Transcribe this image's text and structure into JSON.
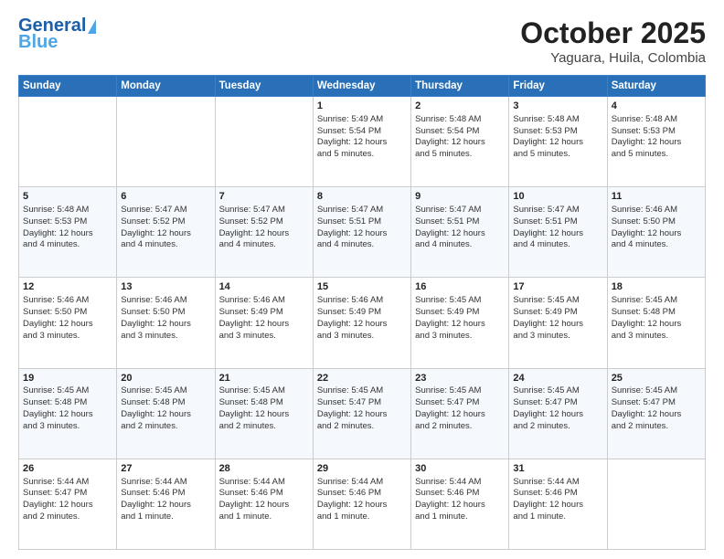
{
  "header": {
    "logo_line1": "General",
    "logo_line2": "Blue",
    "title": "October 2025",
    "subtitle": "Yaguara, Huila, Colombia"
  },
  "days_of_week": [
    "Sunday",
    "Monday",
    "Tuesday",
    "Wednesday",
    "Thursday",
    "Friday",
    "Saturday"
  ],
  "weeks": [
    [
      {
        "day": "",
        "info": ""
      },
      {
        "day": "",
        "info": ""
      },
      {
        "day": "",
        "info": ""
      },
      {
        "day": "1",
        "info": "Sunrise: 5:49 AM\nSunset: 5:54 PM\nDaylight: 12 hours\nand 5 minutes."
      },
      {
        "day": "2",
        "info": "Sunrise: 5:48 AM\nSunset: 5:54 PM\nDaylight: 12 hours\nand 5 minutes."
      },
      {
        "day": "3",
        "info": "Sunrise: 5:48 AM\nSunset: 5:53 PM\nDaylight: 12 hours\nand 5 minutes."
      },
      {
        "day": "4",
        "info": "Sunrise: 5:48 AM\nSunset: 5:53 PM\nDaylight: 12 hours\nand 5 minutes."
      }
    ],
    [
      {
        "day": "5",
        "info": "Sunrise: 5:48 AM\nSunset: 5:53 PM\nDaylight: 12 hours\nand 4 minutes."
      },
      {
        "day": "6",
        "info": "Sunrise: 5:47 AM\nSunset: 5:52 PM\nDaylight: 12 hours\nand 4 minutes."
      },
      {
        "day": "7",
        "info": "Sunrise: 5:47 AM\nSunset: 5:52 PM\nDaylight: 12 hours\nand 4 minutes."
      },
      {
        "day": "8",
        "info": "Sunrise: 5:47 AM\nSunset: 5:51 PM\nDaylight: 12 hours\nand 4 minutes."
      },
      {
        "day": "9",
        "info": "Sunrise: 5:47 AM\nSunset: 5:51 PM\nDaylight: 12 hours\nand 4 minutes."
      },
      {
        "day": "10",
        "info": "Sunrise: 5:47 AM\nSunset: 5:51 PM\nDaylight: 12 hours\nand 4 minutes."
      },
      {
        "day": "11",
        "info": "Sunrise: 5:46 AM\nSunset: 5:50 PM\nDaylight: 12 hours\nand 4 minutes."
      }
    ],
    [
      {
        "day": "12",
        "info": "Sunrise: 5:46 AM\nSunset: 5:50 PM\nDaylight: 12 hours\nand 3 minutes."
      },
      {
        "day": "13",
        "info": "Sunrise: 5:46 AM\nSunset: 5:50 PM\nDaylight: 12 hours\nand 3 minutes."
      },
      {
        "day": "14",
        "info": "Sunrise: 5:46 AM\nSunset: 5:49 PM\nDaylight: 12 hours\nand 3 minutes."
      },
      {
        "day": "15",
        "info": "Sunrise: 5:46 AM\nSunset: 5:49 PM\nDaylight: 12 hours\nand 3 minutes."
      },
      {
        "day": "16",
        "info": "Sunrise: 5:45 AM\nSunset: 5:49 PM\nDaylight: 12 hours\nand 3 minutes."
      },
      {
        "day": "17",
        "info": "Sunrise: 5:45 AM\nSunset: 5:49 PM\nDaylight: 12 hours\nand 3 minutes."
      },
      {
        "day": "18",
        "info": "Sunrise: 5:45 AM\nSunset: 5:48 PM\nDaylight: 12 hours\nand 3 minutes."
      }
    ],
    [
      {
        "day": "19",
        "info": "Sunrise: 5:45 AM\nSunset: 5:48 PM\nDaylight: 12 hours\nand 3 minutes."
      },
      {
        "day": "20",
        "info": "Sunrise: 5:45 AM\nSunset: 5:48 PM\nDaylight: 12 hours\nand 2 minutes."
      },
      {
        "day": "21",
        "info": "Sunrise: 5:45 AM\nSunset: 5:48 PM\nDaylight: 12 hours\nand 2 minutes."
      },
      {
        "day": "22",
        "info": "Sunrise: 5:45 AM\nSunset: 5:47 PM\nDaylight: 12 hours\nand 2 minutes."
      },
      {
        "day": "23",
        "info": "Sunrise: 5:45 AM\nSunset: 5:47 PM\nDaylight: 12 hours\nand 2 minutes."
      },
      {
        "day": "24",
        "info": "Sunrise: 5:45 AM\nSunset: 5:47 PM\nDaylight: 12 hours\nand 2 minutes."
      },
      {
        "day": "25",
        "info": "Sunrise: 5:45 AM\nSunset: 5:47 PM\nDaylight: 12 hours\nand 2 minutes."
      }
    ],
    [
      {
        "day": "26",
        "info": "Sunrise: 5:44 AM\nSunset: 5:47 PM\nDaylight: 12 hours\nand 2 minutes."
      },
      {
        "day": "27",
        "info": "Sunrise: 5:44 AM\nSunset: 5:46 PM\nDaylight: 12 hours\nand 1 minute."
      },
      {
        "day": "28",
        "info": "Sunrise: 5:44 AM\nSunset: 5:46 PM\nDaylight: 12 hours\nand 1 minute."
      },
      {
        "day": "29",
        "info": "Sunrise: 5:44 AM\nSunset: 5:46 PM\nDaylight: 12 hours\nand 1 minute."
      },
      {
        "day": "30",
        "info": "Sunrise: 5:44 AM\nSunset: 5:46 PM\nDaylight: 12 hours\nand 1 minute."
      },
      {
        "day": "31",
        "info": "Sunrise: 5:44 AM\nSunset: 5:46 PM\nDaylight: 12 hours\nand 1 minute."
      },
      {
        "day": "",
        "info": ""
      }
    ]
  ]
}
